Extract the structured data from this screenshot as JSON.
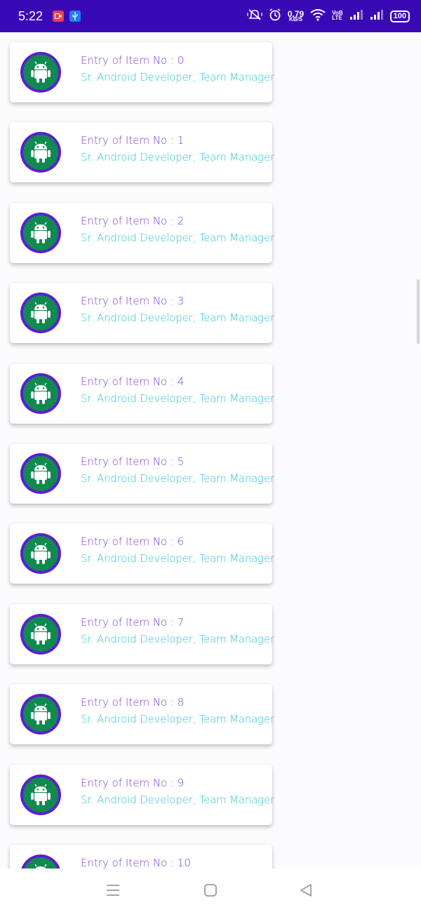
{
  "status_bar": {
    "time": "5:22",
    "net_speed_value": "0.79",
    "net_speed_unit": "KB/S",
    "volte_top": "VoB",
    "volte_bottom": "LTE",
    "battery": "100",
    "background": "#3a09b6"
  },
  "list": {
    "items": [
      {
        "title": "Entry of Item No : 0",
        "subtitle": "Sr. Android Developer, Team Manager"
      },
      {
        "title": "Entry of Item No : 1",
        "subtitle": "Sr. Android Developer, Team Manager"
      },
      {
        "title": "Entry of Item No : 2",
        "subtitle": "Sr. Android Developer, Team Manager"
      },
      {
        "title": "Entry of Item No : 3",
        "subtitle": "Sr. Android Developer, Team Manager"
      },
      {
        "title": "Entry of Item No : 4",
        "subtitle": "Sr. Android Developer, Team Manager"
      },
      {
        "title": "Entry of Item No : 5",
        "subtitle": "Sr. Android Developer, Team Manager"
      },
      {
        "title": "Entry of Item No : 6",
        "subtitle": "Sr. Android Developer, Team Manager"
      },
      {
        "title": "Entry of Item No : 7",
        "subtitle": "Sr. Android Developer, Team Manager"
      },
      {
        "title": "Entry of Item No : 8",
        "subtitle": "Sr. Android Developer, Team Manager"
      },
      {
        "title": "Entry of Item No : 9",
        "subtitle": "Sr. Android Developer, Team Manager"
      },
      {
        "title": "Entry of Item No : 10",
        "subtitle": ""
      }
    ]
  },
  "colors": {
    "title": "#7e3fd1",
    "subtitle": "#2cc6cf",
    "avatar_ring": "#5b1fd0",
    "avatar_fill": "#108a50"
  },
  "icons": {
    "avatar": "android-robot-icon",
    "nav_menu": "menu-icon",
    "nav_home": "home-square-icon",
    "nav_back": "back-triangle-icon"
  }
}
